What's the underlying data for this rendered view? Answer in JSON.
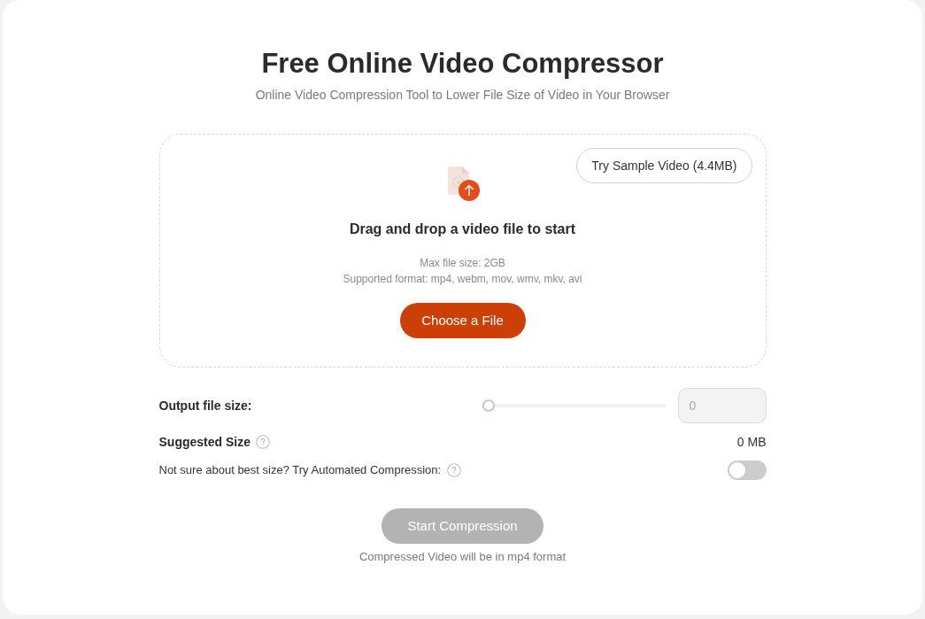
{
  "header": {
    "title": "Free Online Video Compressor",
    "subtitle": "Online Video Compression Tool to Lower File Size of Video in Your Browser"
  },
  "dropzone": {
    "sample_button": "Try Sample Video (4.4MB)",
    "heading": "Drag and drop a video file to start",
    "max_size": "Max file size: 2GB",
    "formats": "Supported format: mp4, webm, mov, wmv, mkv, avi",
    "choose_button": "Choose a File"
  },
  "output_size": {
    "label": "Output file size:",
    "slider": {
      "level": 0
    },
    "input": {
      "value": "0",
      "disabled": true
    }
  },
  "suggested_size": {
    "label": "Suggested Size",
    "value": "0 MB"
  },
  "auto_compression": {
    "label": "Not sure about best size? Try Automated Compression:",
    "on": false
  },
  "start_button": {
    "label": "Start Compression",
    "disabled": true
  },
  "note": "Compressed Video will be in mp4 format"
}
